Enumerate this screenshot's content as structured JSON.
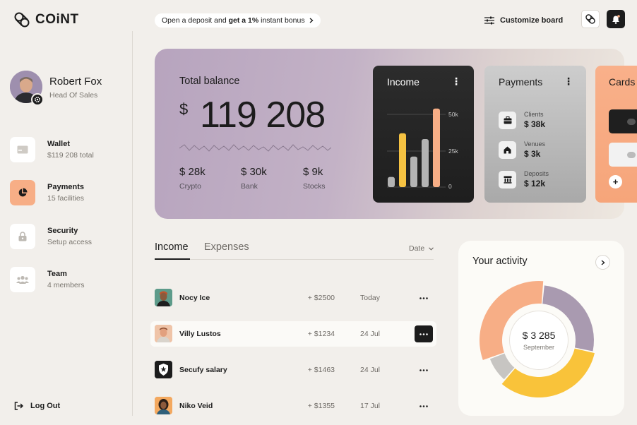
{
  "brand": {
    "name": "COiNT"
  },
  "profile": {
    "name": "Robert Fox",
    "role": "Head Of Sales"
  },
  "nav": [
    {
      "title": "Wallet",
      "sub": "$119 208 total",
      "icon": "wallet-icon"
    },
    {
      "title": "Payments",
      "sub": "15 facilities",
      "icon": "pie-chart-icon",
      "active": true
    },
    {
      "title": "Security",
      "sub": "Setup access",
      "icon": "lock-icon"
    },
    {
      "title": "Team",
      "sub": "4 members",
      "icon": "team-icon"
    }
  ],
  "logout": {
    "label": "Log Out"
  },
  "promo": {
    "pre": "Open a deposit and ",
    "bold": "get a 1%",
    "post": " instant bonus"
  },
  "topbar": {
    "customize_label": "Customize board"
  },
  "balance": {
    "title": "Total balance",
    "currency": "$",
    "amount": "119 208",
    "breakdown": [
      {
        "value": "$ 28k",
        "label": "Crypto"
      },
      {
        "value": "$ 30k",
        "label": "Bank"
      },
      {
        "value": "$ 9k",
        "label": "Stocks"
      }
    ]
  },
  "income_card": {
    "title": "Income",
    "axis": [
      "50k",
      "25k",
      "0"
    ],
    "bars": [
      {
        "value": 7,
        "color": "#b3b3b3"
      },
      {
        "value": 37,
        "color": "#f5c242"
      },
      {
        "value": 21,
        "color": "#b3b3b3"
      },
      {
        "value": 33,
        "color": "#b3b3b3"
      },
      {
        "value": 54,
        "color": "#f7ae86"
      }
    ]
  },
  "payments_card": {
    "title": "Payments",
    "rows": [
      {
        "label": "Clients",
        "value": "$ 38k",
        "icon": "briefcase-icon"
      },
      {
        "label": "Venues",
        "value": "$ 3k",
        "icon": "home-icon"
      },
      {
        "label": "Deposits",
        "value": "$ 12k",
        "icon": "bank-icon"
      }
    ]
  },
  "cards_card": {
    "title": "Cards"
  },
  "tabs": {
    "income": "Income",
    "expenses": "Expenses",
    "date_filter": "Date"
  },
  "transactions": [
    {
      "name": "Nocy Ice",
      "amount": "+ $2500",
      "date": "Today",
      "avatar_color": "#4a8c7c"
    },
    {
      "name": "Villy Lustos",
      "amount": "+ $1234",
      "date": "24 Jul",
      "avatar_color": "#e8b89a",
      "highlight": true
    },
    {
      "name": "Secufy salary",
      "amount": "+ $1463",
      "date": "24 Jul",
      "avatar_color": "#1c1c1c"
    },
    {
      "name": "Niko Veid",
      "amount": "+ $1355",
      "date": "17 Jul",
      "avatar_color": "#f0a462"
    }
  ],
  "activity": {
    "title": "Your activity",
    "total": "$ 3 285",
    "period": "September",
    "segments": [
      {
        "share": 0.27,
        "color": "#a99ab0"
      },
      {
        "share": 0.33,
        "color": "#f9c33a"
      },
      {
        "share": 0.08,
        "color": "#c7c5c2"
      },
      {
        "share": 0.32,
        "color": "#f7ae86"
      }
    ]
  }
}
